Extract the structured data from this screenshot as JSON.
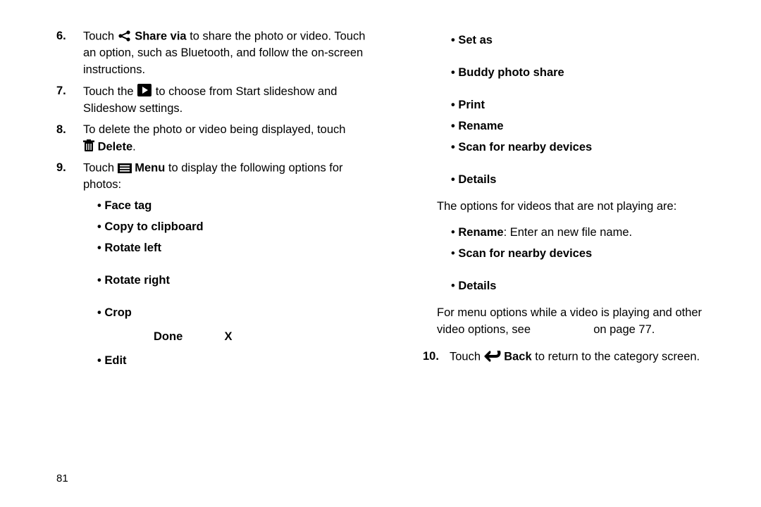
{
  "left": {
    "steps": [
      {
        "num": "6.",
        "pre": "Touch ",
        "icon": "share",
        "bold": " Share via",
        "post": " to share the photo or video. Touch an option, such as Bluetooth, and follow the on-screen instructions."
      },
      {
        "num": "7.",
        "pre": "Touch the ",
        "icon": "play",
        "post": " to choose from Start slideshow and Slideshow settings."
      },
      {
        "num": "8.",
        "line1": "To delete the photo or video being displayed, touch",
        "icon": "trash",
        "bold": " Delete",
        "post": "."
      },
      {
        "num": "9.",
        "pre": "Touch ",
        "icon": "menu",
        "bold": " Menu",
        "post": " to display the following options for photos:"
      }
    ],
    "photo_opts": [
      "Face tag",
      "Copy to clipboard",
      "Rotate left",
      "Rotate right",
      "Crop",
      "Edit"
    ],
    "crop_done": "Done",
    "crop_x": "X"
  },
  "right": {
    "opts1": [
      "Set as",
      "Buddy photo share",
      "Print",
      "Rename",
      "Scan for nearby devices",
      "Details"
    ],
    "para1": "The options for videos that are not playing are:",
    "video_opts": [
      {
        "b": "Rename",
        "rest": ": Enter an new file name."
      },
      {
        "b": "Scan for nearby devices",
        "rest": ""
      },
      {
        "b": "Details",
        "rest": ""
      }
    ],
    "para2a": "For menu options while a video is playing and other video options, see ",
    "para2b": " on page 77.",
    "step10": {
      "num": "10.",
      "pre": "Touch ",
      "icon": "back",
      "bold": " Back",
      "post": " to return to the category screen."
    }
  },
  "page_num": "81"
}
